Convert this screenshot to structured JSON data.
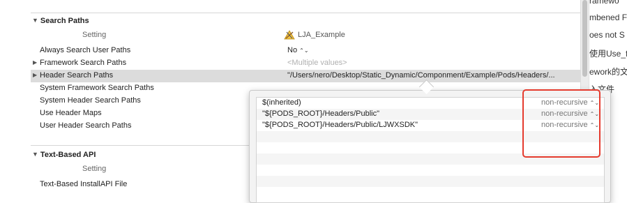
{
  "search_paths": {
    "title": "Search Paths",
    "setting_col": "Setting",
    "target_name": "LJA_Example",
    "rows": [
      {
        "name": "Always Search User Paths",
        "value": "No",
        "disclosure": false,
        "value_style": "popup"
      },
      {
        "name": "Framework Search Paths",
        "value": "<Multiple values>",
        "disclosure": true,
        "value_style": "placeholder"
      },
      {
        "name": "Header Search Paths",
        "value": "\"/Users/nero/Desktop/Static_Dynamic/Componment/Example/Pods/Headers/...",
        "disclosure": true,
        "value_style": "text",
        "selected": true
      },
      {
        "name": "System Framework Search Paths",
        "value": "",
        "disclosure": false
      },
      {
        "name": "System Header Search Paths",
        "value": "",
        "disclosure": false
      },
      {
        "name": "Use Header Maps",
        "value": "",
        "disclosure": false
      },
      {
        "name": "User Header Search Paths",
        "value": "",
        "disclosure": false
      }
    ]
  },
  "text_based_api": {
    "title": "Text-Based API",
    "setting_col": "Setting",
    "rows": [
      {
        "name": "Text-Based InstallAPI File",
        "value": ""
      }
    ]
  },
  "popover": {
    "paths": [
      {
        "path": "$(inherited)",
        "recursion": "non-recursive"
      },
      {
        "path": "\"${PODS_ROOT}/Headers/Public\"",
        "recursion": "non-recursive"
      },
      {
        "path": "\"${PODS_ROOT}/Headers/Public/LJWXSDK\"",
        "recursion": "non-recursive"
      }
    ]
  },
  "side_doc": {
    "lines": [
      "ramewo",
      "mbened F",
      "oes not S",
      "使用Use_f",
      "ework的文",
      "入文件"
    ]
  },
  "colors": {
    "highlight": "#e53b2e",
    "selected_row": "#dcdcdc"
  }
}
